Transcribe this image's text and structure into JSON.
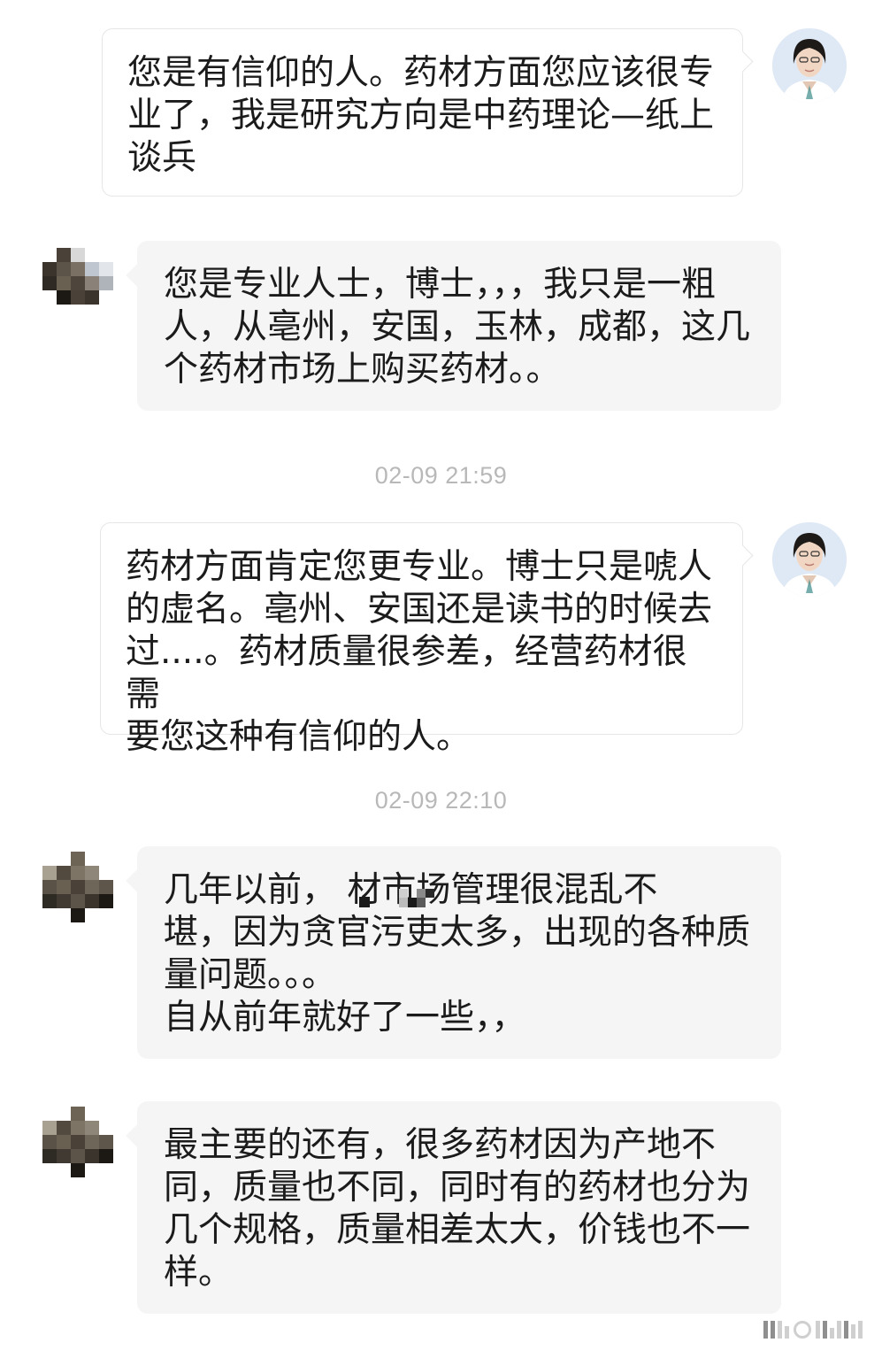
{
  "messages": [
    {
      "sender": "doctor",
      "text": "您是有信仰的人。药材方面您应该很专\n业了，我是研究方向是中药理论—纸上\n谈兵"
    },
    {
      "sender": "contact",
      "text": "您是专业人士，博士，，，我只是一粗\n人，从亳州，安国，玉林，成都，这几\n个药材市场上购买药材。。"
    },
    {
      "timestamp": "02-09 21:59"
    },
    {
      "sender": "doctor",
      "text": "药材方面肯定您更专业。博士只是唬人\n的虚名。亳州、安国还是读书的时候去\n过....。药材质量很参差，经营药材很需\n要您这种有信仰的人。"
    },
    {
      "timestamp": "02-09 22:10"
    },
    {
      "sender": "contact",
      "text": "几年以前，          材市场管理很混乱不\n堪，因为贪官污吏太多，出现的各种质\n量问题。。。\n自从前年就好了一些，，"
    },
    {
      "sender": "contact",
      "text": "最主要的还有，很多药材因为产地不\n同，质量也不同，同时有的药材也分为\n几个规格，质量相差太大，价钱也不一\n样。"
    }
  ],
  "colors": {
    "timestamp": "#b8b8b8",
    "incoming_bubble": "#f5f5f5",
    "outgoing_bubble": "#ffffff",
    "text": "#1b1b1b"
  },
  "icons": {
    "doctor_avatar": "doctor-portrait",
    "contact_avatar": "pixelated-photo",
    "watermark": "platform-watermark"
  }
}
